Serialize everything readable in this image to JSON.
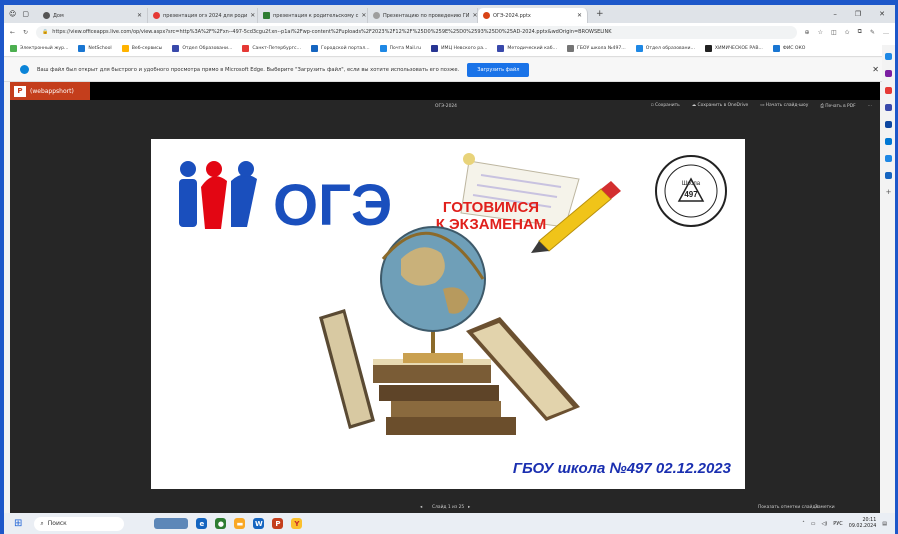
{
  "tabs": [
    {
      "label": "Дом",
      "color": "#555"
    },
    {
      "label": "презентация огэ 2024 для роди",
      "color": "#e53935"
    },
    {
      "label": "презентация к родительскому с",
      "color": "#2e7d32"
    },
    {
      "label": "Презентацию по проведению ГИ",
      "color": "#9e9e9e"
    },
    {
      "label": "ОГЭ-2024.pptx",
      "color": "#d84315"
    }
  ],
  "address": {
    "url": "https://view.officeapps.live.com/op/view.aspx?src=http%3A%2F%2Fxn--497-5cd3cgu2f.xn--p1ai%2Fwp-content%2Fuploads%2F2023%2F12%2F%25D0%259E%25D0%2593%25D0%25AD-2024.pptx&wdOrigin=BROWSELINK"
  },
  "favorites": [
    {
      "label": "Электронный жур...",
      "color": "#4caf50"
    },
    {
      "label": "NetSchool",
      "color": "#1976d2"
    },
    {
      "label": "Веб-сервисы",
      "color": "#ffb300"
    },
    {
      "label": "Отдел Образовани...",
      "color": "#3949ab"
    },
    {
      "label": "Санкт-Петербургс...",
      "color": "#e53935"
    },
    {
      "label": "Городской портал...",
      "color": "#1565c0"
    },
    {
      "label": "Почта Mail.ru",
      "color": "#1e88e5"
    },
    {
      "label": "ИМЦ Невского ра...",
      "color": "#283593"
    },
    {
      "label": "Методический каб...",
      "color": "#3949ab"
    },
    {
      "label": "ГБОУ школа №497...",
      "color": "#757575"
    },
    {
      "label": "Отдел образовани...",
      "color": "#1e88e5"
    },
    {
      "label": "ХИМИЧЕСКОЕ РАВ...",
      "color": "#212121"
    },
    {
      "label": "ФИС ОКО",
      "color": "#1976d2"
    }
  ],
  "infobar": {
    "text": "Ваш файл был открыт для быстрого и удобного просмотра прямо в Microsoft Edge. Выберите \"Загрузить файл\", если вы хотите использовать его позже.",
    "button": "Загрузить файл"
  },
  "app": {
    "file_label": "(webappshort)",
    "doc_title": "ОГЭ-2024",
    "tools": [
      "Сохранить",
      "Сохранить в OneDrive",
      "Начать слайд-шоу",
      "Печать в PDF"
    ]
  },
  "slide": {
    "logo_text": "ОГЭ",
    "headline_line1": "ГОТОВИМСЯ",
    "headline_line2": "К ЭКЗАМЕНАМ",
    "emblem_text1": "Школа",
    "emblem_text2": "497",
    "footer": "ГБОУ школа №497  02.12.2023"
  },
  "status": {
    "slide_counter": "Слайд 1 из 25",
    "notes": "Показать отметки слайда",
    "zoom": "Заметки"
  },
  "taskbar": {
    "search_placeholder": "Поиск",
    "lang": "РУС",
    "time": "20:11",
    "date": "09.02.2024"
  },
  "colors": {
    "accent": "#1d57c9",
    "ppt": "#c43e1c",
    "logo_blue": "#1a4fbd",
    "logo_red": "#e30613",
    "headline": "#e0201c"
  }
}
